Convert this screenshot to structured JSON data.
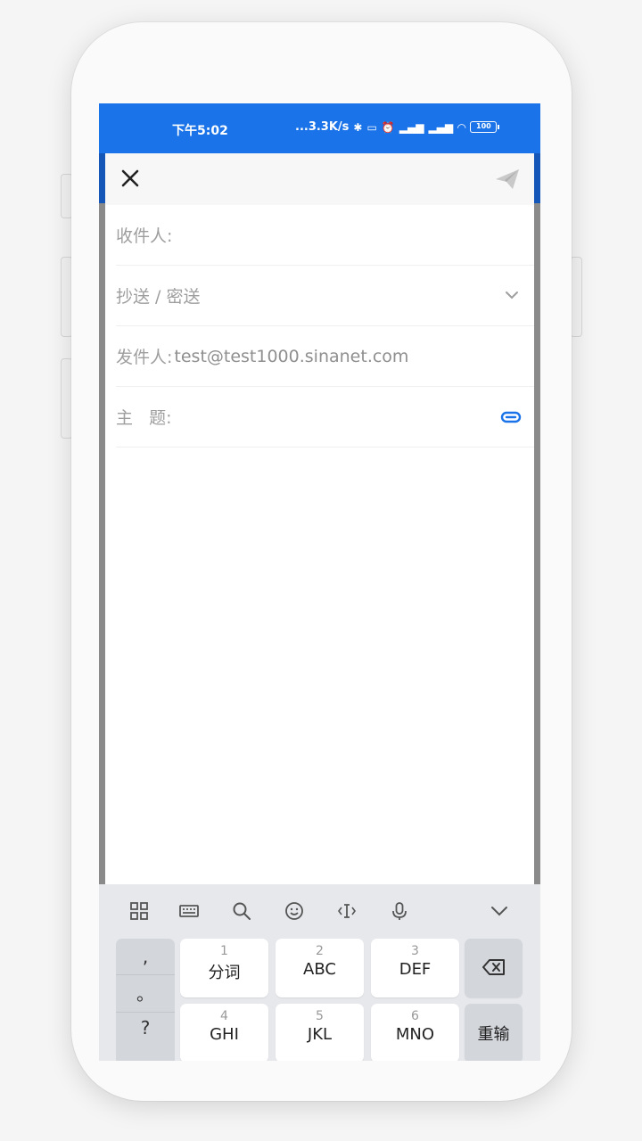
{
  "status_bar": {
    "time": "下午5:02",
    "net_speed": "...3.3K/s",
    "battery": "100"
  },
  "compose": {
    "to_label": "收件人:",
    "cc_bcc_label": "抄送 / 密送",
    "from_label": "发件人:",
    "from_value": "test@test1000.sinanet.com",
    "subject_label": "主   题:"
  },
  "keyboard": {
    "punct": [
      ",",
      "。",
      "?"
    ],
    "keys_row1": [
      {
        "num": "1",
        "label": "分词"
      },
      {
        "num": "2",
        "label": "ABC"
      },
      {
        "num": "3",
        "label": "DEF"
      }
    ],
    "keys_row2": [
      {
        "num": "4",
        "label": "GHI"
      },
      {
        "num": "5",
        "label": "JKL"
      },
      {
        "num": "6",
        "label": "MNO"
      }
    ],
    "reinput_label": "重输"
  },
  "colors": {
    "status_bar": "#1a73e8",
    "accent": "#1a73e8"
  }
}
